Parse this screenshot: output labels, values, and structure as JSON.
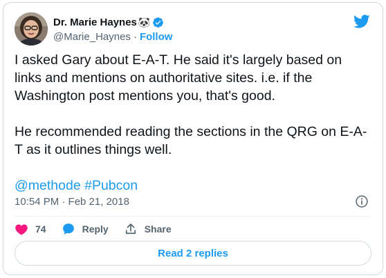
{
  "author": {
    "display_name": "Dr. Marie Haynes",
    "emoji": "🐼",
    "handle": "@Marie_Haynes",
    "separator": "·",
    "follow_label": "Follow"
  },
  "tweet": {
    "text_main": "I asked Gary about E-A-T. He said it's largely based on links and mentions on authoritative sites. i.e. if the Washington post mentions you, that's good.\n\nHe recommended reading the sections in the QRG on E-A-T as it outlines things well.\n\n",
    "mention": "@methode",
    "hashtag": "#Pubcon",
    "timestamp": "10:54 PM · Feb 21, 2018"
  },
  "actions": {
    "like_count": "74",
    "reply_label": "Reply",
    "share_label": "Share"
  },
  "read_replies_label": "Read 2 replies",
  "colors": {
    "accent": "#1d9bf0",
    "like": "#f91880",
    "text": "#0f1419",
    "muted": "#536471",
    "border": "#cfd9de"
  },
  "icons": [
    "twitter-bird-icon",
    "verified-badge-icon",
    "info-icon",
    "heart-icon",
    "reply-icon",
    "share-icon"
  ]
}
